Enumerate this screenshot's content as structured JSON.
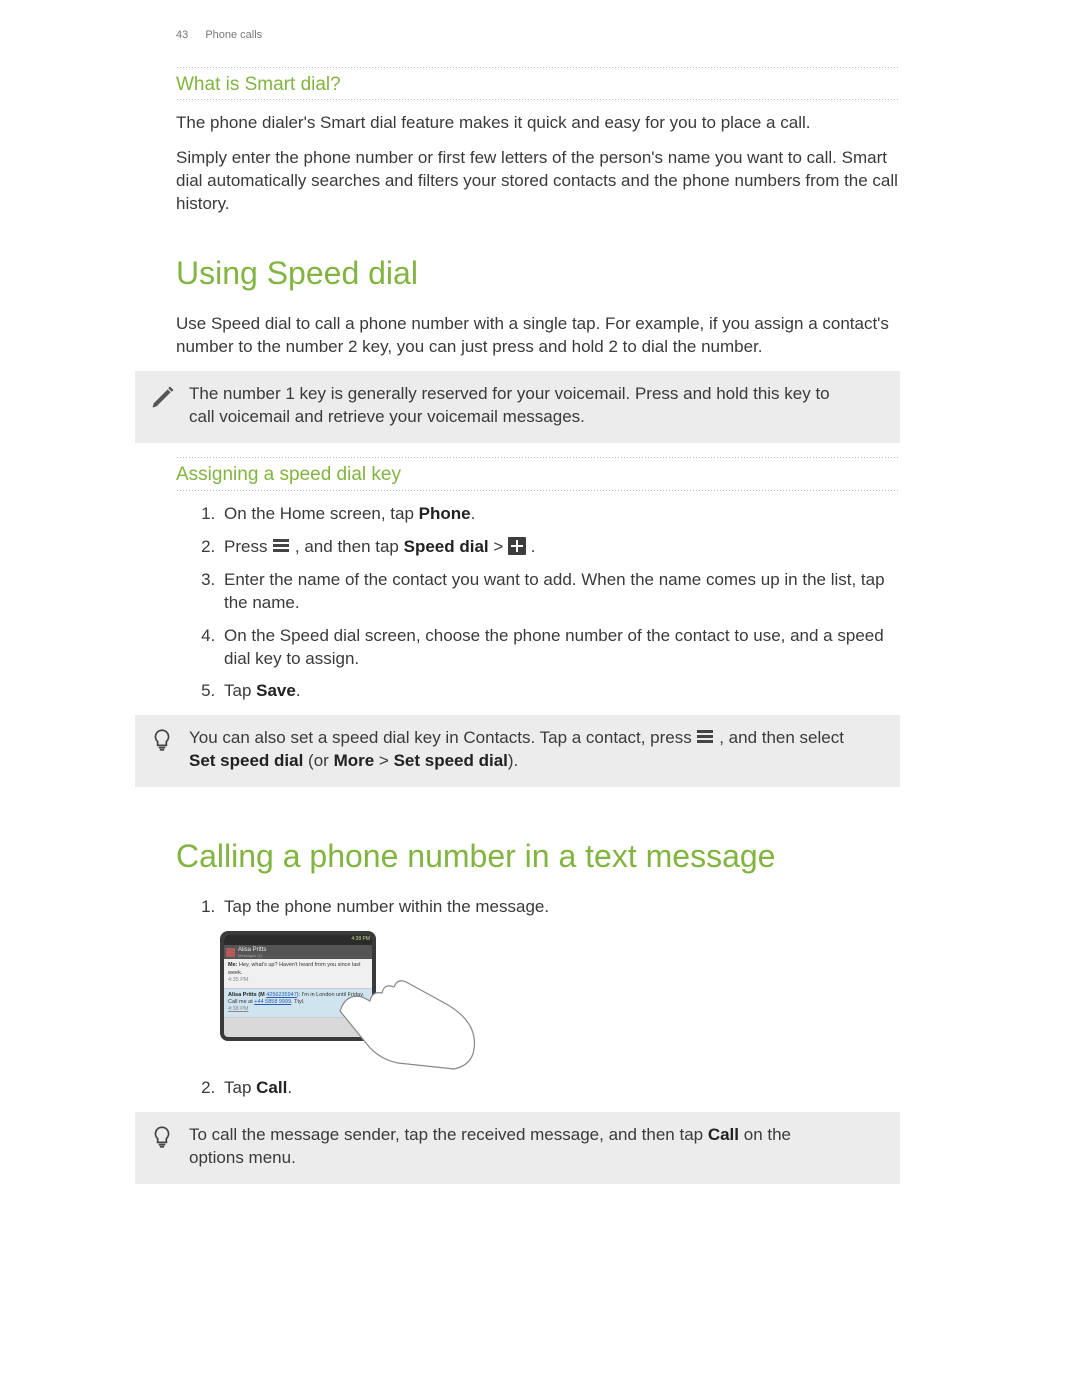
{
  "header": {
    "page_number": "43",
    "section": "Phone calls"
  },
  "smartdial": {
    "heading": "What is Smart dial?",
    "p1": "The phone dialer's Smart dial feature makes it quick and easy for you to place a call.",
    "p2": "Simply enter the phone number or first few letters of the person's name you want to call. Smart dial automatically searches and filters your stored contacts and the phone numbers from the call history."
  },
  "speeddial": {
    "heading": "Using Speed dial",
    "intro": "Use Speed dial to call a phone number with a single tap. For example, if you assign a contact's number to the number 2 key, you can just press and hold 2 to dial the number.",
    "note1": "The number 1 key is generally reserved for your voicemail. Press and hold this key to call voicemail and retrieve your voicemail messages.",
    "assign_heading": "Assigning a speed dial key",
    "steps": {
      "s1a": "On the Home screen, tap ",
      "s1b": "Phone",
      "s1c": ".",
      "s2a": "Press ",
      "s2b": " , and then tap ",
      "s2c": "Speed dial",
      "s2d": " > ",
      "s2e": " .",
      "s3": "Enter the name of the contact you want to add. When the name comes up in the list, tap the name.",
      "s4": "On the Speed dial screen, choose the phone number of the contact to use, and a speed dial key to assign.",
      "s5a": "Tap ",
      "s5b": "Save",
      "s5c": "."
    },
    "tip": {
      "a": "You can also set a speed dial key in Contacts. Tap a contact, press ",
      "b": " , and then select ",
      "c": "Set speed dial",
      "d": " (or ",
      "e": "More",
      "f": " > ",
      "g": "Set speed dial",
      "h": ")."
    }
  },
  "textcall": {
    "heading": "Calling a phone number in a text message",
    "step1": "Tap the phone number within the message.",
    "step2a": "Tap ",
    "step2b": "Call",
    "step2c": ".",
    "tip": {
      "a": "To call the message sender, tap the received message, and then tap ",
      "b": "Call",
      "c": " on the options menu."
    }
  },
  "illustration": {
    "status_time": "4:38 PM",
    "contact_name": "Alisa Pritts",
    "thread_sub": "Messages (2)",
    "msg1_prefix": "Me: ",
    "msg1_body": "Hey, what's up? Haven't heard from you since last week.",
    "msg1_time": "4:35 PM",
    "msg2_name": "Alisa Pritts (M ",
    "msg2_num1": "4256235947",
    "msg2_mid": "): I'm in London until Friday. Call me at ",
    "msg2_num2": "+44 5858 9999",
    "msg2_tail": ". Ttyl.",
    "msg2_time": "4:38 PM"
  }
}
